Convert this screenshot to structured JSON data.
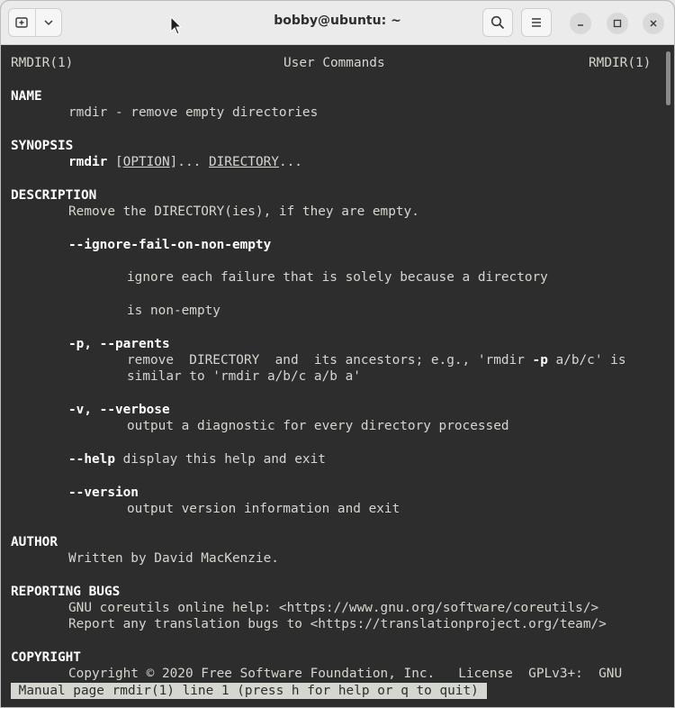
{
  "window": {
    "title": "bobby@ubuntu: ~"
  },
  "icons": {
    "new_tab": "new-tab-icon",
    "menu_dropdown": "chevron-down-icon",
    "search": "search-icon",
    "hamburger": "hamburger-menu-icon",
    "minimize": "minimize-icon",
    "maximize": "maximize-icon",
    "close": "close-icon"
  },
  "man": {
    "header_left": "RMDIR(1)",
    "header_center": "User Commands",
    "header_right": "RMDIR(1)",
    "name_heading": "NAME",
    "name_text": "rmdir - remove empty directories",
    "synopsis_heading": "SYNOPSIS",
    "synopsis_cmd": "rmdir",
    "synopsis_open": " [",
    "synopsis_option": "OPTION",
    "synopsis_mid": "]... ",
    "synopsis_dir": "DIRECTORY",
    "synopsis_end": "...",
    "description_heading": "DESCRIPTION",
    "description_text": "Remove the DIRECTORY(ies), if they are empty.",
    "opt1_flag": "--ignore-fail-on-non-empty",
    "opt1_line1": "ignore each failure that is solely because a directory",
    "opt1_line2": "is non-empty",
    "opt2_flag": "-p, --parents",
    "opt2_line1_a": "remove  DIRECTORY  and  its ancestors; e.g., 'rmdir ",
    "opt2_line1_flag": "-p",
    "opt2_line1_b": " a/b/c' is",
    "opt2_line2": "similar to 'rmdir a/b/c a/b a'",
    "opt3_flag": "-v, --verbose",
    "opt3_line1": "output a diagnostic for every directory processed",
    "opt4_flag": "--help",
    "opt4_text": " display this help and exit",
    "opt5_flag": "--version",
    "opt5_line1": "output version information and exit",
    "author_heading": "AUTHOR",
    "author_text": "Written by David MacKenzie.",
    "bugs_heading": "REPORTING BUGS",
    "bugs_line1": "GNU coreutils online help: <https://www.gnu.org/software/coreutils/>",
    "bugs_line2": "Report any translation bugs to <https://translationproject.org/team/>",
    "copyright_heading": "COPYRIGHT",
    "copyright_line1": "Copyright © 2020 Free Software Foundation, Inc.   License  GPLv3+:  GNU",
    "status_line": " Manual page rmdir(1) line 1 (press h for help or q to quit) "
  }
}
